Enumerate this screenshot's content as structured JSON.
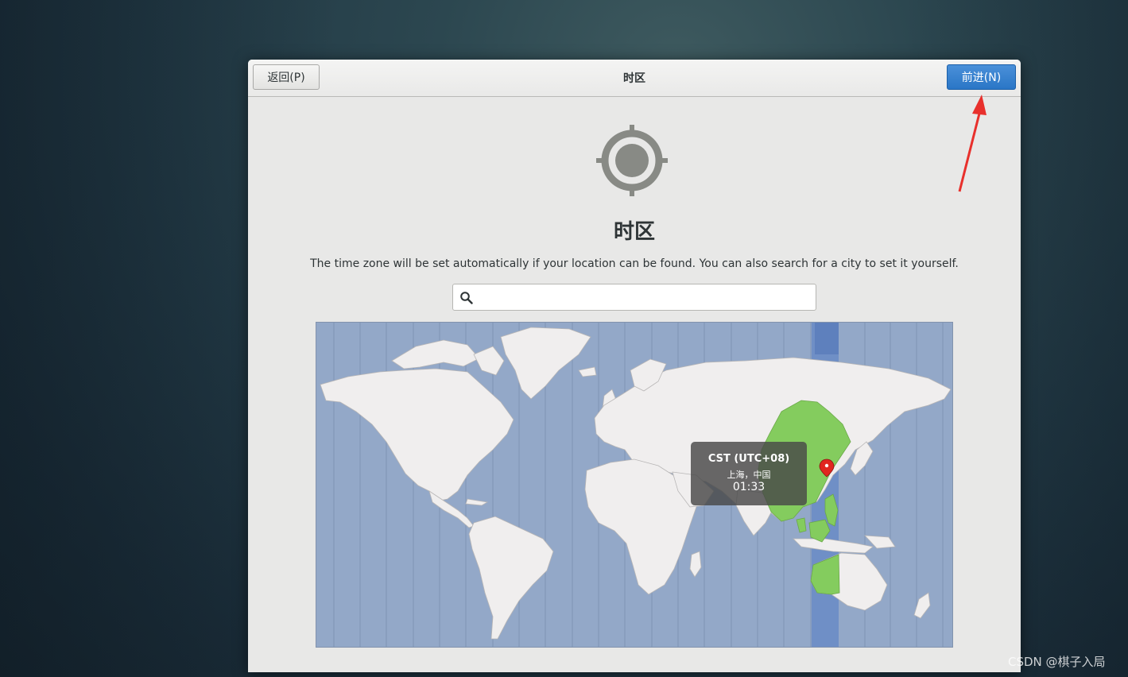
{
  "header": {
    "back_label": "返回(P)",
    "title": "时区",
    "next_label": "前进(N)"
  },
  "main": {
    "icon": "location-crosshair-icon",
    "title": "时区",
    "description": "The time zone will be set automatically if your location can be found. You can also search for a city to set it yourself.",
    "search": {
      "icon": "search-icon",
      "value": "",
      "placeholder": ""
    }
  },
  "map": {
    "selected_timezone": {
      "zone": "CST (UTC+08)",
      "city": "上海，中国",
      "time": "01:33"
    },
    "marker_icon": "location-pin-icon",
    "colors": {
      "ocean": "#93a8c8",
      "land": "#f0eeee",
      "selected_zone_land": "#84cc5e",
      "selected_zone_band": "#6f8fc6"
    }
  },
  "annotation": {
    "arrow_color": "#e8302c",
    "arrow_icon": "red-arrow-icon"
  },
  "watermark": "CSDN @棋子入局"
}
